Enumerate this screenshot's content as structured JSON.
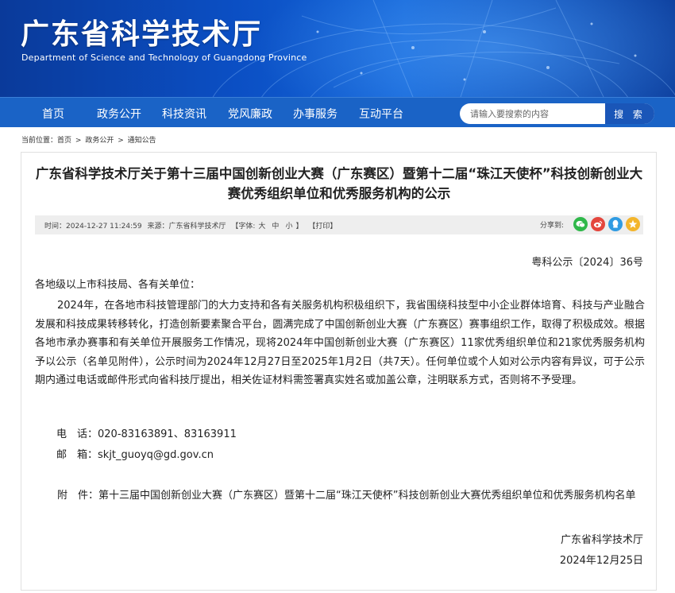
{
  "header": {
    "title": "广东省科学技术厅",
    "subtitle": "Department of Science and Technology of Guangdong Province"
  },
  "nav": {
    "items": [
      {
        "label": "首页"
      },
      {
        "label": "政务公开"
      },
      {
        "label": "科技资讯"
      },
      {
        "label": "党风廉政"
      },
      {
        "label": "办事服务"
      },
      {
        "label": "互动平台"
      }
    ],
    "search_placeholder": "请输入要搜索的内容",
    "search_button": "搜 索"
  },
  "breadcrumb": {
    "prefix": "当前位置：",
    "items": [
      "首页",
      "政务公开",
      "通知公告"
    ],
    "separator": ">"
  },
  "article": {
    "title": "广东省科学技术厅关于第十三届中国创新创业大赛（广东赛区）暨第十二届“珠江天使杯”科技创新创业大赛优秀组织单位和优秀服务机构的公示",
    "meta": {
      "time": "时间：2024-12-27 11:24:59",
      "source": "来源：广东省科学技术厅",
      "font_label": "【字体:",
      "font_sizes": [
        "大",
        "中",
        "小"
      ],
      "font_close": "】",
      "print": "【打印】",
      "share_label": "分享到:"
    },
    "share_icons": [
      {
        "icon": "wechat-icon",
        "color": "#2fb84a"
      },
      {
        "icon": "weibo-icon",
        "color": "#e4463d"
      },
      {
        "icon": "qq-icon",
        "color": "#2f9be2"
      },
      {
        "icon": "qzone-icon",
        "color": "#f3b52c"
      }
    ],
    "doc_no": "粤科公示〔2024〕36号",
    "addressee": "各地级以上市科技局、各有关单位：",
    "paragraph": "2024年，在各地市科技管理部门的大力支持和各有关服务机构积极组织下，我省围绕科技型中小企业群体培育、科技与产业融合发展和科技成果转移转化，打造创新要素聚合平台，圆满完成了中国创新创业大赛（广东赛区）赛事组织工作，取得了积极成效。根据各地市承办赛事和有关单位开展服务工作情况，现将2024年中国创新创业大赛（广东赛区）11家优秀组织单位和21家优秀服务机构予以公示（名单见附件），公示时间为2024年12月27日至2025年1月2日（共7天）。任何单位或个人如对公示内容有异议，可于公示期内通过电话或邮件形式向省科技厅提出，相关佐证材料需签署真实姓名或加盖公章，注明联系方式，否则将不予受理。",
    "phone_label": "电　话：",
    "phone": "020-83163891、83163911",
    "email_label": "邮　箱：",
    "email": "skjt_guoyq@gd.gov.cn",
    "attachment": "附　件：第十三届中国创新创业大赛（广东赛区）暨第十二届“珠江天使杯”科技创新创业大赛优秀组织单位和优秀服务机构名单",
    "signer": "广东省科学技术厅",
    "date": "2024年12月25日"
  }
}
